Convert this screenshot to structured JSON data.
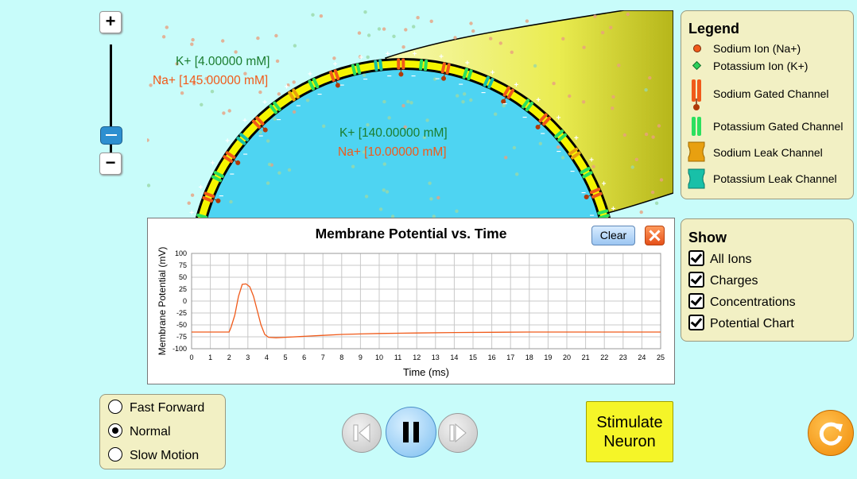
{
  "zoom": {
    "plus_label": "+",
    "minus_label": "−"
  },
  "concentrations": {
    "outside_k": "K+ [4.00000 mM]",
    "outside_na": "Na+ [145.00000 mM]",
    "inside_k": "K+ [140.00000 mM]",
    "inside_na": "Na+ [10.00000 mM]"
  },
  "legend": {
    "title": "Legend",
    "items": [
      {
        "label": "Sodium Ion (Na+)",
        "icon": "sodium-ion-icon"
      },
      {
        "label": "Potassium Ion (K+)",
        "icon": "potassium-ion-icon"
      },
      {
        "label": "Sodium Gated Channel",
        "icon": "sodium-gated-channel-icon"
      },
      {
        "label": "Potassium Gated Channel",
        "icon": "potassium-gated-channel-icon"
      },
      {
        "label": "Sodium Leak Channel",
        "icon": "sodium-leak-channel-icon"
      },
      {
        "label": "Potassium Leak Channel",
        "icon": "potassium-leak-channel-icon"
      }
    ]
  },
  "show": {
    "title": "Show",
    "options": [
      {
        "label": "All Ions",
        "checked": true
      },
      {
        "label": "Charges",
        "checked": true
      },
      {
        "label": "Concentrations",
        "checked": true
      },
      {
        "label": "Potential Chart",
        "checked": true
      }
    ]
  },
  "chart": {
    "clear_label": "Clear"
  },
  "speed": {
    "options": [
      {
        "label": "Fast Forward",
        "selected": false
      },
      {
        "label": "Normal",
        "selected": true
      },
      {
        "label": "Slow Motion",
        "selected": false
      }
    ]
  },
  "stimulate_label": "Stimulate Neuron",
  "colors": {
    "sodium": "#f05a1a",
    "potassium": "#1b7d2f",
    "membrane": "#f5f500",
    "cell_interior": "#4ed4f2",
    "background": "#c8fcfa"
  },
  "chart_data": {
    "type": "line",
    "title": "Membrane Potential vs. Time",
    "xlabel": "Time (ms)",
    "ylabel": "Membrane Potential (mV)",
    "xlim": [
      0,
      25
    ],
    "ylim": [
      -100,
      100
    ],
    "xticks": [
      0,
      1,
      2,
      3,
      4,
      5,
      6,
      7,
      8,
      9,
      10,
      11,
      12,
      13,
      14,
      15,
      16,
      17,
      18,
      19,
      20,
      21,
      22,
      23,
      24,
      25
    ],
    "yticks": [
      100,
      75,
      50,
      25,
      0,
      -25,
      -50,
      -75,
      -100
    ],
    "grid": true,
    "series": [
      {
        "color": "#f05a1a",
        "x": [
          0,
          2.0,
          2.1,
          2.3,
          2.5,
          2.7,
          2.9,
          3.1,
          3.3,
          3.5,
          3.7,
          3.9,
          4.1,
          4.5,
          5,
          6,
          7,
          8,
          9,
          10,
          12,
          14,
          16,
          18,
          20,
          22,
          25
        ],
        "y": [
          -65,
          -65,
          -55,
          -30,
          10,
          35,
          36,
          30,
          10,
          -20,
          -50,
          -70,
          -76,
          -77,
          -76,
          -74,
          -72,
          -70,
          -69,
          -68,
          -67,
          -66,
          -65.5,
          -65,
          -65,
          -65,
          -65
        ]
      }
    ]
  }
}
